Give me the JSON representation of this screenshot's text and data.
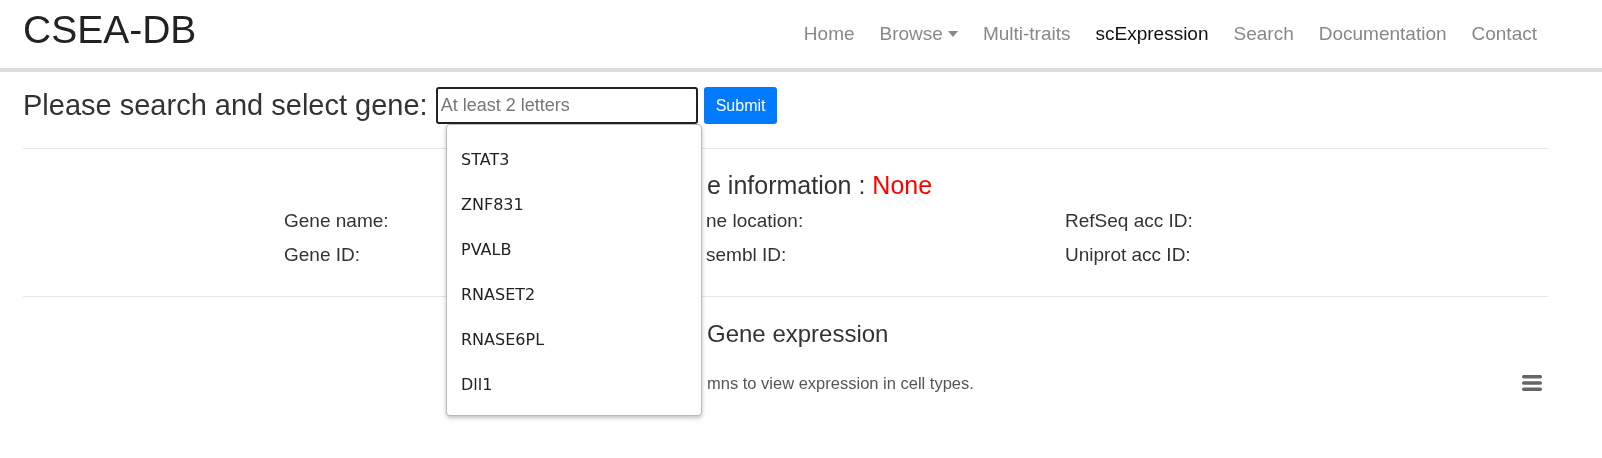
{
  "brand": "CSEA-DB",
  "nav": {
    "items": [
      {
        "label": "Home",
        "kind": "link",
        "selected": false
      },
      {
        "label": "Browse",
        "kind": "dropdown",
        "selected": false
      },
      {
        "label": "Multi-traits",
        "kind": "link",
        "selected": false
      },
      {
        "label": "scExpression",
        "kind": "link",
        "selected": true
      },
      {
        "label": "Search",
        "kind": "link",
        "selected": false
      },
      {
        "label": "Documentation",
        "kind": "link",
        "selected": false
      },
      {
        "label": "Contact",
        "kind": "link",
        "selected": false
      }
    ]
  },
  "search": {
    "label": "Please search and select gene:",
    "placeholder": "At least 2 letters",
    "button": "Submit",
    "suggestions": [
      "STAT3",
      "ZNF831",
      "PVALB",
      "RNASET2",
      "RNASE6PL",
      "Dll1"
    ]
  },
  "gene_info": {
    "heading": "e information :",
    "value": "None",
    "rows": [
      [
        "Gene name:",
        "ne location:",
        "RefSeq acc ID:"
      ],
      [
        "Gene ID:",
        "sembl ID:",
        "Uniprot acc ID:"
      ]
    ]
  },
  "expression": {
    "heading": "Gene expression",
    "note": "mns to view expression in cell types."
  }
}
